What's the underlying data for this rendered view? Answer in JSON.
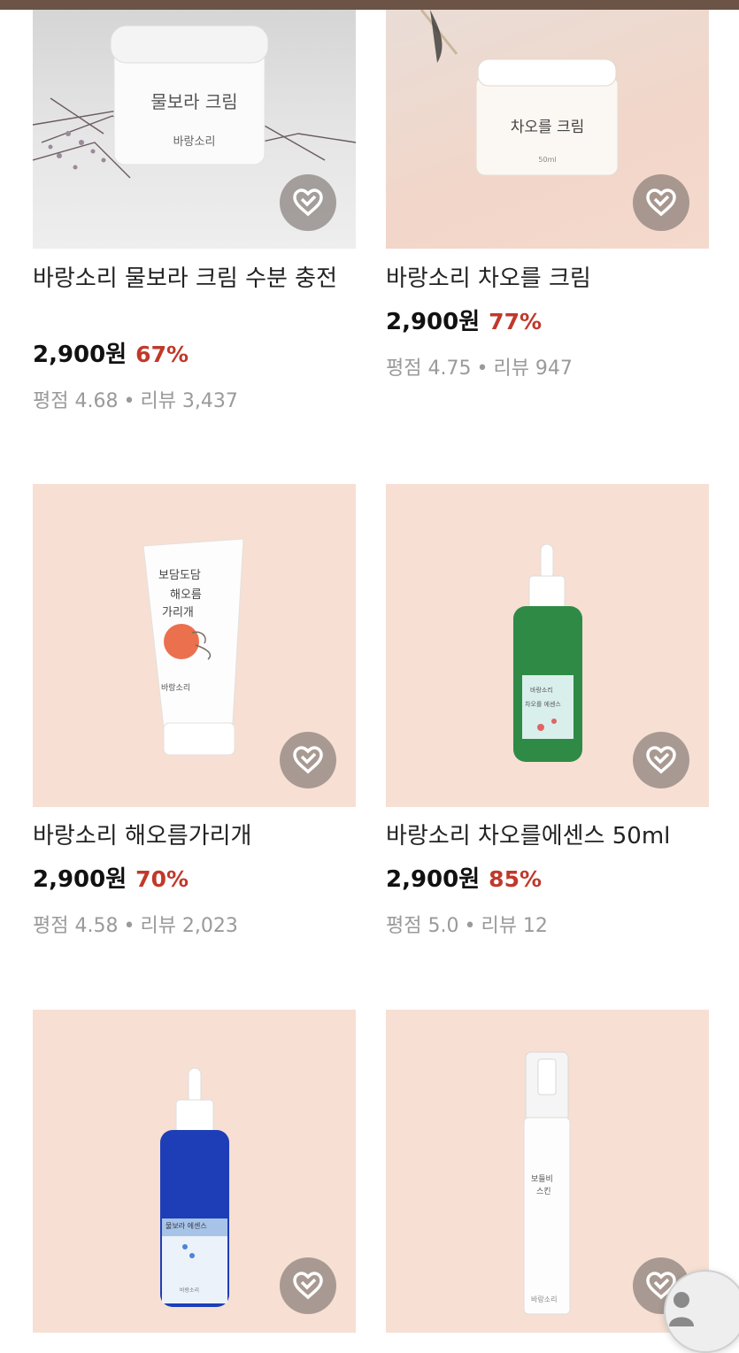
{
  "colors": {
    "topbar": "#6b5446",
    "discount": "#c0392b",
    "meta": "#9a9a9a"
  },
  "products": [
    {
      "title": "바랑소리 물보라 크림 수분 충전",
      "price": "2,900원",
      "discount": "67%",
      "rating_label": "평점 4.68",
      "reviews_label": "리뷰 3,437",
      "image_text": {
        "line1": "물보라 크림",
        "line2": "바랑소리"
      },
      "wishlist_icon": "heart-icon"
    },
    {
      "title": "바랑소리 차오를 크림",
      "price": "2,900원",
      "discount": "77%",
      "rating_label": "평점 4.75",
      "reviews_label": "리뷰 947",
      "image_text": {
        "line1": "차오를 크림",
        "line2": "50ml"
      },
      "wishlist_icon": "heart-icon"
    },
    {
      "title": "바랑소리 해오름가리개",
      "price": "2,900원",
      "discount": "70%",
      "rating_label": "평점 4.58",
      "reviews_label": "리뷰 2,023",
      "image_text": {
        "line1": "보담도담",
        "line2": "해오름",
        "line3": "가리개",
        "line4": "바랑소리"
      },
      "wishlist_icon": "heart-icon"
    },
    {
      "title": "바랑소리 차오를에센스 50ml",
      "price": "2,900원",
      "discount": "85%",
      "rating_label": "평점 5.0",
      "reviews_label": "리뷰 12",
      "image_text": {
        "line1": "바랑소리",
        "line2": "차오를 에센스"
      },
      "wishlist_icon": "heart-icon"
    },
    {
      "title": "",
      "price": "",
      "discount": "",
      "rating_label": "",
      "reviews_label": "",
      "image_text": {
        "line1": "물보라 에센스",
        "line2": "바랑소리"
      },
      "wishlist_icon": "heart-icon"
    },
    {
      "title": "",
      "price": "",
      "discount": "",
      "rating_label": "",
      "reviews_label": "",
      "image_text": {
        "line1": "보들비",
        "line2": "스킨",
        "line3": "바랑소리"
      },
      "wishlist_icon": "heart-icon"
    }
  ],
  "separator": "•",
  "floating_button_icon": "person-icon"
}
